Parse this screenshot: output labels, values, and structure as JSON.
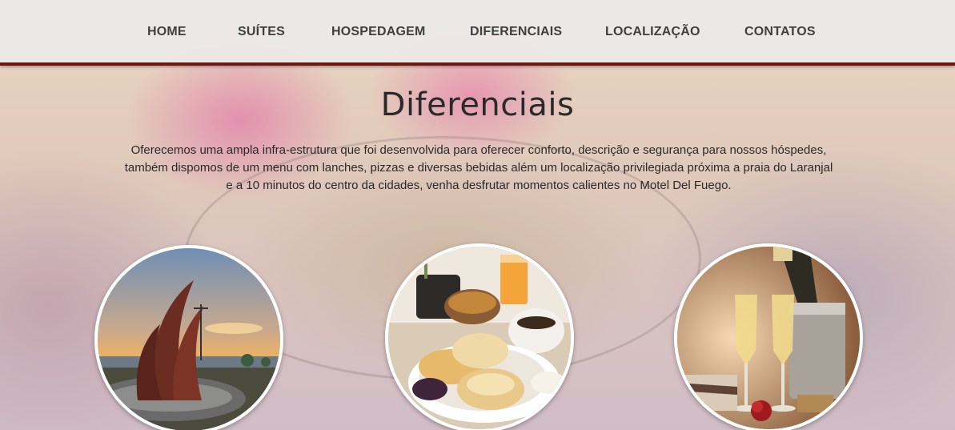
{
  "nav": {
    "items": [
      {
        "label": "HOME"
      },
      {
        "label": "SUÍTES"
      },
      {
        "label": "HOSPEDAGEM"
      },
      {
        "label": "DIFERENCIAIS"
      },
      {
        "label": "LOCALIZAÇÃO"
      },
      {
        "label": "CONTATOS"
      }
    ],
    "bar_color": "#ECE9E8",
    "underline_color": "#6B1714"
  },
  "section": {
    "title": "Diferenciais",
    "text": "Oferecemos uma ampla infra-estrutura que foi desenvolvida para oferecer conforto, descrição e segurança para nossos hóspedes, também dispomos de um menu com lanches, pizzas e diversas bebidas além um localização privilegiada próxima a praia do Laranjal e a 10 minutos do centro da cidades, venha desfrutar momentos calientes no Motel Del Fuego."
  },
  "photos": [
    {
      "subject": "sunset-sculpture"
    },
    {
      "subject": "breakfast"
    },
    {
      "subject": "champagne"
    }
  ]
}
